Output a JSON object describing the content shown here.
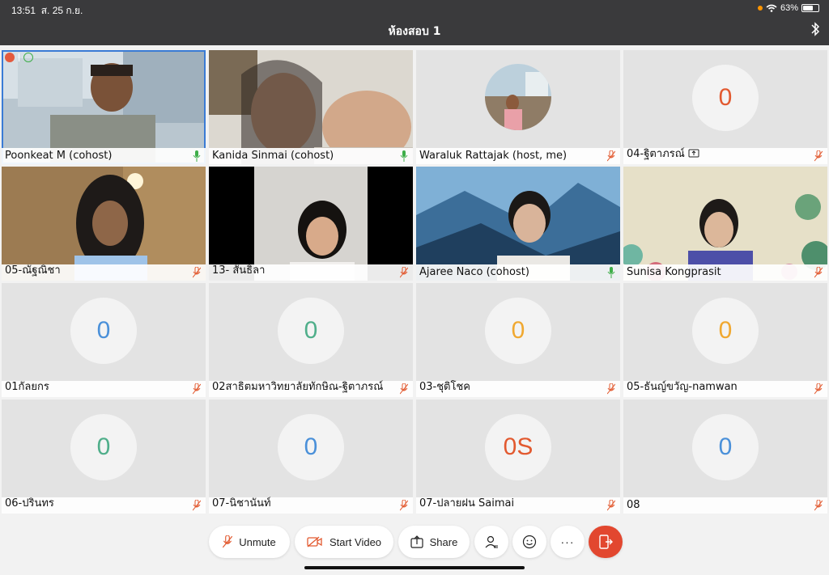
{
  "status_bar": {
    "time": "13:51",
    "date": "ส. 25 ก.ย.",
    "battery": "63%"
  },
  "meeting": {
    "title": "ห้องสอบ 1"
  },
  "participants": [
    {
      "name": "Poonkeat M (cohost)",
      "mic": "on",
      "kind": "video"
    },
    {
      "name": "Kanida Sinmai (cohost)",
      "mic": "on",
      "kind": "video"
    },
    {
      "name": "Waraluk Rattajak (host, me)",
      "mic": "muted",
      "kind": "photo"
    },
    {
      "name": "04-ฐิตาภรณ์",
      "mic": "muted",
      "kind": "avatar",
      "initials": "0",
      "color": "#e2592f",
      "sharing": true
    },
    {
      "name": "05-ณัฐณิชา",
      "mic": "muted",
      "kind": "video"
    },
    {
      "name": "13- สันธิลา",
      "mic": "muted",
      "kind": "video"
    },
    {
      "name": "Ajaree Naco (cohost)",
      "mic": "on",
      "kind": "video"
    },
    {
      "name": "Sunisa Kongprasit",
      "mic": "muted",
      "kind": "video"
    },
    {
      "name": "01กัลยกร",
      "mic": "muted",
      "kind": "avatar",
      "initials": "0",
      "color": "#4a90d9"
    },
    {
      "name": "02สาธิตมหาวิทยาลัยทักษิณ-ฐิตาภรณ์",
      "mic": "muted",
      "kind": "avatar",
      "initials": "0",
      "color": "#4fae8a"
    },
    {
      "name": "03-ชุติโชค",
      "mic": "muted",
      "kind": "avatar",
      "initials": "0",
      "color": "#f0a830"
    },
    {
      "name": "05-ธันญ์ขวัญ-namwan",
      "mic": "muted",
      "kind": "avatar",
      "initials": "0",
      "color": "#f0a830"
    },
    {
      "name": "06-ปรินทร",
      "mic": "muted",
      "kind": "avatar",
      "initials": "0",
      "color": "#4fae8a"
    },
    {
      "name": "07-นิชานันท์",
      "mic": "muted",
      "kind": "avatar",
      "initials": "0",
      "color": "#4a90d9"
    },
    {
      "name": "07-ปลายฝน Saimai",
      "mic": "muted",
      "kind": "avatar",
      "initials": "0S",
      "color": "#e2592f"
    },
    {
      "name": "08",
      "mic": "muted",
      "kind": "avatar",
      "initials": "0",
      "color": "#4a90d9"
    }
  ],
  "toolbar": {
    "unmute": "Unmute",
    "start_video": "Start Video",
    "share": "Share",
    "more": "···"
  },
  "colors": {
    "muted_mic": "#e2592f",
    "live_mic": "#3fae4a",
    "leave": "#e2472f",
    "topbar": "#3a3a3c"
  }
}
